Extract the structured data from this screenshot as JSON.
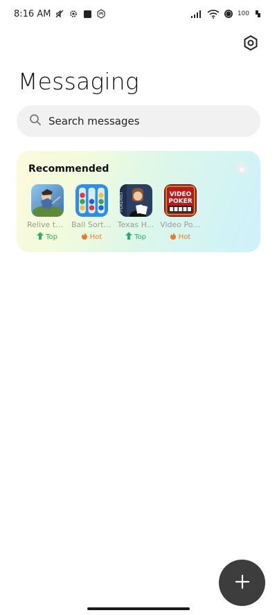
{
  "status_bar": {
    "time": "8:16 AM",
    "battery_level": "100",
    "icons_left": [
      "mute-icon",
      "gear-icon",
      "square-icon",
      "mi-icon"
    ],
    "icons_right": [
      "signal-icon",
      "wifi-icon",
      "battery-icon",
      "fist-icon"
    ]
  },
  "header": {
    "title": "Messaging",
    "settings_icon": "settings-hexagon-icon"
  },
  "search": {
    "placeholder": "Search messages",
    "icon": "search-icon"
  },
  "recommended": {
    "title": "Recommended",
    "close_icon": "close-icon",
    "apps": [
      {
        "name": "Relive th...",
        "badge": "Top",
        "badge_type": "top"
      },
      {
        "name": "Ball Sort:...",
        "badge": "Hot",
        "badge_type": "hot"
      },
      {
        "name": "Texas H...",
        "badge": "Top",
        "badge_type": "top"
      },
      {
        "name": "Video Po...",
        "badge": "Hot",
        "badge_type": "hot"
      }
    ]
  },
  "fab": {
    "icon": "plus-icon"
  },
  "colors": {
    "top_badge": "#22b26c",
    "hot_badge": "#f0781e",
    "fab_bg": "#3d3d3d",
    "search_bg": "#f1f1f1"
  }
}
